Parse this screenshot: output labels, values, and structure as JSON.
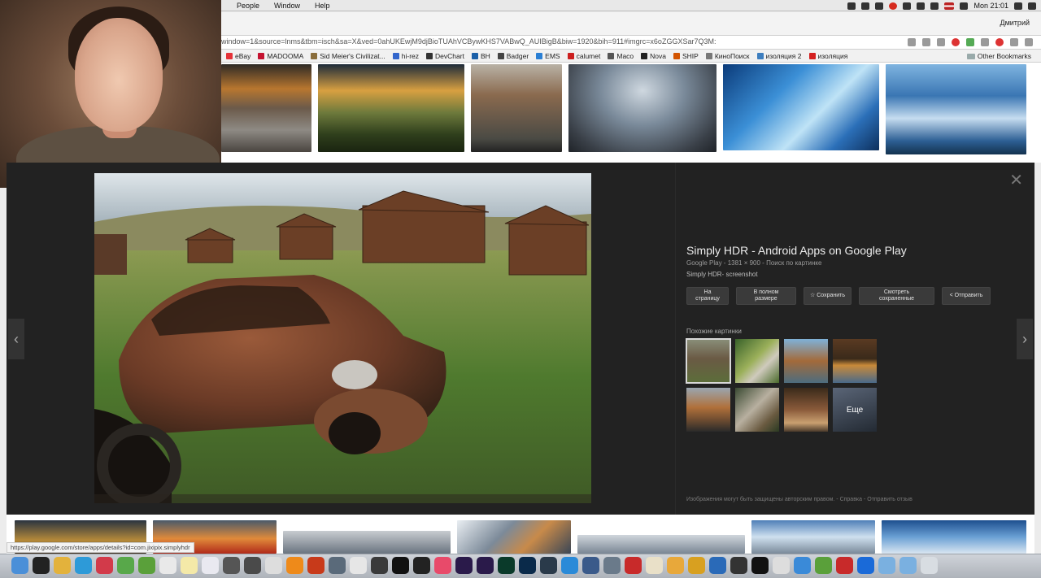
{
  "menubar": {
    "menus": [
      "People",
      "Window",
      "Help"
    ],
    "clock": "Mon 21:01"
  },
  "browser": {
    "user_name": "Дмитрий",
    "url": "window=1&source=lnms&tbm=isch&sa=X&ved=0ahUKEwjM9djBioTUAhVCBywKHS7VABwQ_AUIBigB&biw=1920&bih=911#imgrc=x6oZGGXSar7Q3M:",
    "bookmarks": [
      {
        "label": "eBay",
        "color": "#e53238"
      },
      {
        "label": "MADOOMA",
        "color": "#c41230"
      },
      {
        "label": "Sid Meier's Civilizat...",
        "color": "#8a6d3b"
      },
      {
        "label": "hi-rez",
        "color": "#3366cc"
      },
      {
        "label": "DevChart",
        "color": "#333333"
      },
      {
        "label": "BH",
        "color": "#1a5fa8"
      },
      {
        "label": "Badger",
        "color": "#444444"
      },
      {
        "label": "EMS",
        "color": "#2a7fd4"
      },
      {
        "label": "calumet",
        "color": "#cc1f1f"
      },
      {
        "label": "Maco",
        "color": "#555555"
      },
      {
        "label": "Nova",
        "color": "#222222"
      },
      {
        "label": "SHIP",
        "color": "#d35400"
      },
      {
        "label": "КиноПоиск",
        "color": "#777777"
      },
      {
        "label": "изоляция 2",
        "color": "#3d7ebf"
      },
      {
        "label": "изоляция",
        "color": "#d42020"
      }
    ],
    "other_bookmarks": "Other Bookmarks",
    "status_url": "https://play.google.com/store/apps/details?id=com.jixipix.simplyhdr"
  },
  "viewer": {
    "close_icon": "close-icon",
    "title": "Simply HDR - Android Apps on Google Play",
    "meta": "Google Play - 1381 × 900 - Поиск по картинке",
    "description": "Simply HDR- screenshot",
    "buttons": {
      "visit": "На\nстраницу",
      "full_size": "В полном\nразмере",
      "save": "☆ Сохранить",
      "view_saved": "Смотреть\nсохраненные",
      "share": "< Отправить"
    },
    "similar_label": "Похожие картинки",
    "more_label": "Еще",
    "disclaimer": "Изображения могут быть защищены авторским правом. - Справка - Отправить отзыв"
  }
}
